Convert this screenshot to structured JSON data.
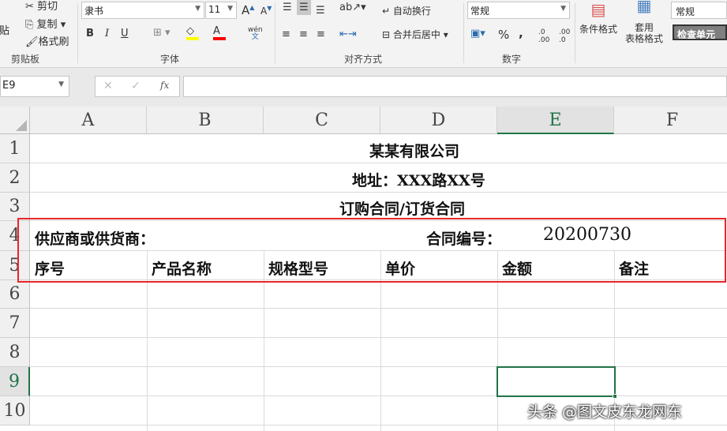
{
  "ribbon": {
    "clipboard": {
      "paste": "粘贴",
      "cut": "剪切",
      "copy": "复制",
      "format_painter": "格式刷",
      "group": "剪贴板"
    },
    "font": {
      "name": "隶书",
      "size": "11",
      "bold": "B",
      "italic": "I",
      "underline": "U",
      "phonetic": "wén",
      "phonetic_sub": "文",
      "group": "字体",
      "fill_color": "#ffff00",
      "font_color": "#ff0000"
    },
    "alignment": {
      "wrap": "自动换行",
      "merge": "合并后居中",
      "group": "对齐方式"
    },
    "number": {
      "format": "常规",
      "percent": "%",
      "comma": ",",
      "group": "数字"
    },
    "styles": {
      "conditional": "条件格式",
      "table_format_1": "套用",
      "table_format_2": "表格格式",
      "style_normal": "常规",
      "style_check": "检查单元"
    }
  },
  "formula_bar": {
    "name_box": "E9",
    "fx": "fx",
    "value": ""
  },
  "sheet": {
    "columns": [
      "A",
      "B",
      "C",
      "D",
      "E",
      "F"
    ],
    "rows": [
      "1",
      "2",
      "3",
      "4",
      "5",
      "6",
      "7",
      "8",
      "9",
      "10"
    ],
    "selected_cell": "E9",
    "title": "某某有限公司",
    "address": "地址：XXX路XX号",
    "subtitle": "订购合同/订货合同",
    "supplier": "供应商或供货商：",
    "contract_no_label": "合同编号：",
    "contract_no": "20200730",
    "headers": [
      "序号",
      "产品名称",
      "规格型号",
      "单价",
      "金额",
      "备注"
    ]
  },
  "watermark": "头条 @图文皮东龙网东",
  "highlight_color": "#e8262b"
}
